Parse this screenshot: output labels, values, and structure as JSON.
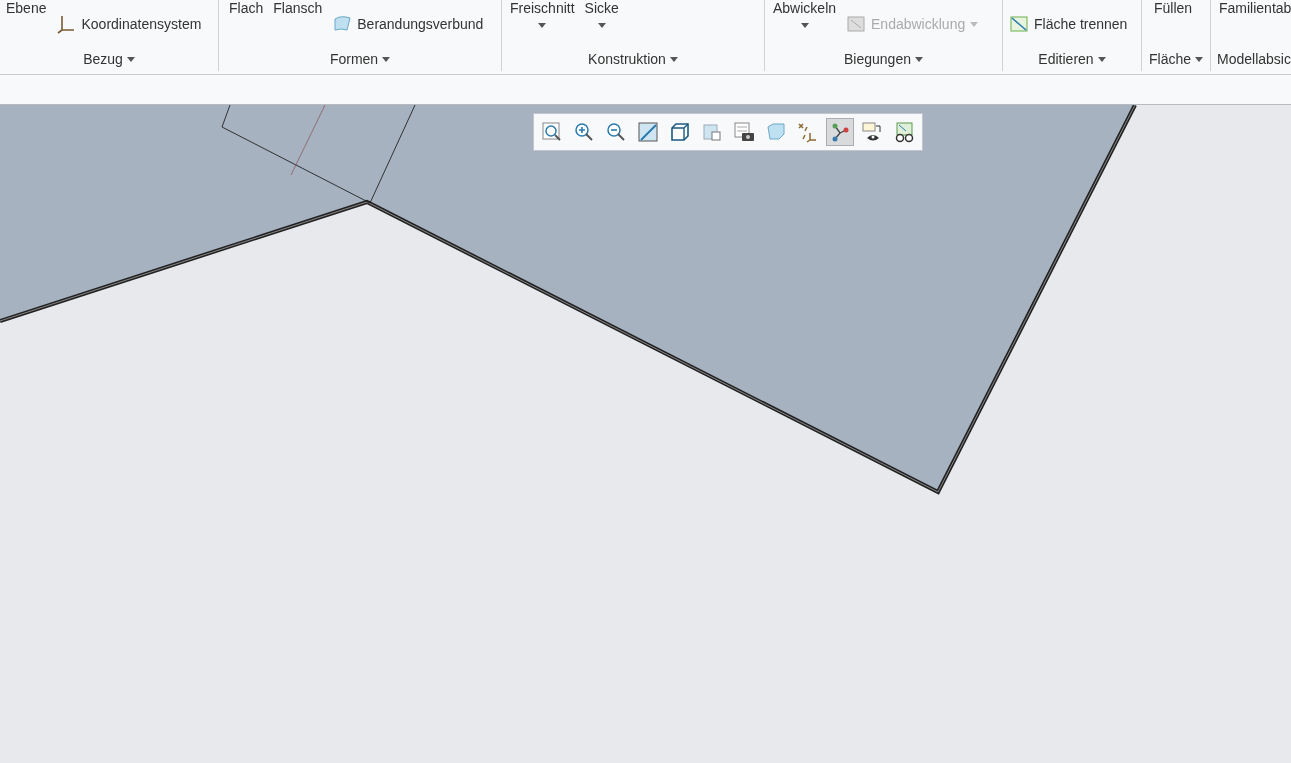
{
  "ribbon": {
    "groups": [
      {
        "label": "Bezug",
        "menu": true,
        "items": [
          {
            "text": "Ebene",
            "kind": "plain"
          },
          {
            "text": "Koordinatensystem",
            "kind": "small",
            "disabled": false,
            "menu": false
          }
        ]
      },
      {
        "label": "Formen",
        "menu": true,
        "items": [
          {
            "text": "Flach",
            "kind": "plain"
          },
          {
            "text": "Flansch",
            "kind": "plain"
          },
          {
            "text": "Berandungsverbund",
            "kind": "small",
            "disabled": false,
            "menu": false
          }
        ]
      },
      {
        "label": "Konstruktion",
        "menu": true,
        "items": [
          {
            "text": "Freischnitt",
            "kind": "split"
          },
          {
            "text": "Sicke",
            "kind": "split"
          }
        ]
      },
      {
        "label": "Biegungen",
        "menu": true,
        "items": [
          {
            "text": "Abwickeln",
            "kind": "split"
          },
          {
            "text": "Endabwicklung",
            "kind": "small",
            "disabled": true,
            "menu": true
          }
        ]
      },
      {
        "label": "Editieren",
        "menu": true,
        "items": [
          {
            "text": "Fläche trennen",
            "kind": "small",
            "disabled": false,
            "menu": false
          }
        ]
      },
      {
        "label": "Fläche",
        "menu": true,
        "items": [
          {
            "text": "Füllen",
            "kind": "plain"
          }
        ]
      },
      {
        "label": "Modellabsic",
        "menu": false,
        "items": [
          {
            "text": "Familientab",
            "kind": "plain"
          }
        ]
      }
    ]
  },
  "view_toolbar": [
    {
      "selected": false
    },
    {
      "selected": false
    },
    {
      "selected": false
    },
    {
      "selected": false
    },
    {
      "selected": false
    },
    {
      "selected": false
    },
    {
      "selected": false
    },
    {
      "selected": false
    },
    {
      "selected": false
    },
    {
      "selected": true
    },
    {
      "selected": false
    },
    {
      "selected": false
    }
  ]
}
